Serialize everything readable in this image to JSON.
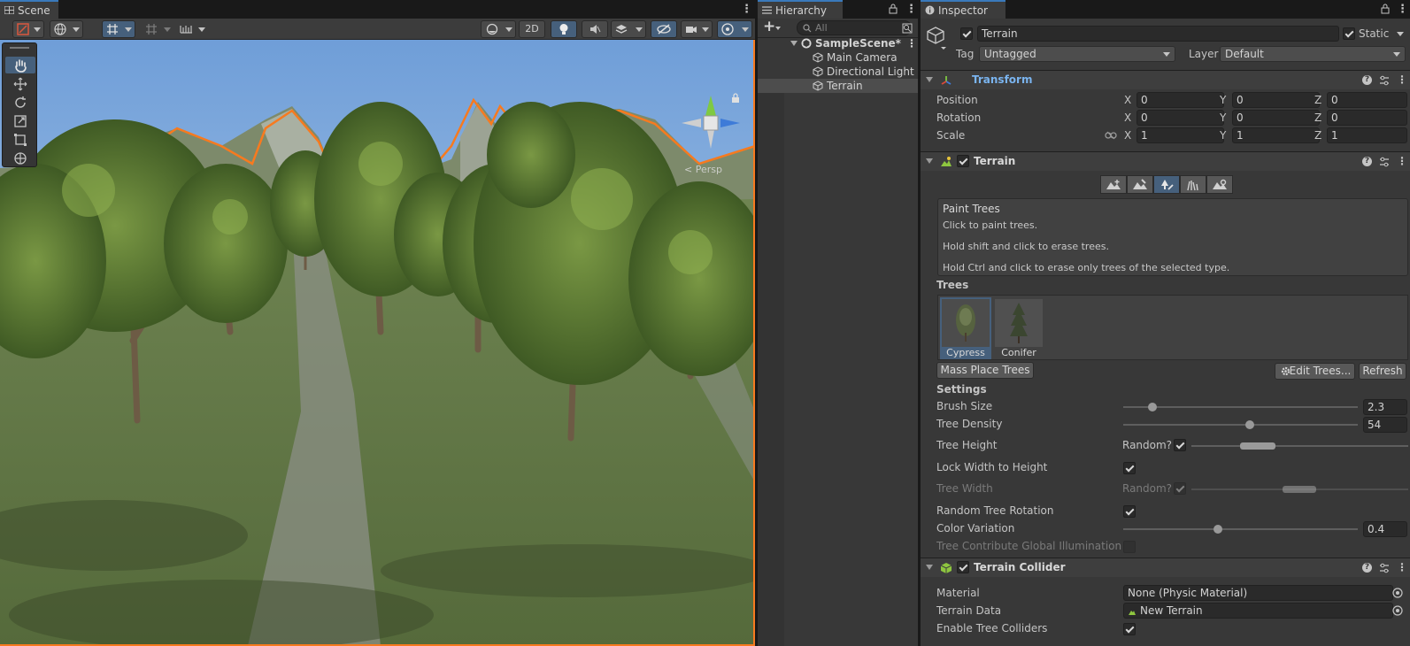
{
  "scene": {
    "tab": "Scene",
    "btn_2d": "2D",
    "persp_label": "< Persp"
  },
  "hierarchy": {
    "tab": "Hierarchy",
    "search_placeholder": "All",
    "scene_name": "SampleScene*",
    "items": [
      {
        "label": "Main Camera"
      },
      {
        "label": "Directional Light"
      },
      {
        "label": "Terrain"
      }
    ]
  },
  "inspector": {
    "tab": "Inspector",
    "object_name": "Terrain",
    "static_label": "Static",
    "tag_label": "Tag",
    "tag_value": "Untagged",
    "layer_label": "Layer",
    "layer_value": "Default",
    "transform": {
      "title": "Transform",
      "position_label": "Position",
      "rotation_label": "Rotation",
      "scale_label": "Scale",
      "axis_x": "X",
      "axis_y": "Y",
      "axis_z": "Z",
      "position": [
        "0",
        "0",
        "0"
      ],
      "rotation": [
        "0",
        "0",
        "0"
      ],
      "scale": [
        "1",
        "1",
        "1"
      ]
    },
    "terrain": {
      "title": "Terrain",
      "help_title": "Paint Trees",
      "help_lines": [
        "Click to paint trees.",
        "Hold shift and click to erase trees.",
        "Hold Ctrl and click to erase only trees of the selected type."
      ],
      "trees_label": "Trees",
      "trees": [
        {
          "name": "Cypress"
        },
        {
          "name": "Conifer"
        }
      ],
      "mass_place_btn": "Mass Place Trees",
      "edit_trees_btn": "Edit Trees...",
      "refresh_btn": "Refresh",
      "settings_label": "Settings",
      "brush_size_label": "Brush Size",
      "brush_size": "2.3",
      "brush_size_slider": 0.11,
      "tree_density_label": "Tree Density",
      "tree_density": "54",
      "tree_density_slider": 0.54,
      "tree_height_label": "Tree Height",
      "random_label": "Random?",
      "lock_width_label": "Lock Width to Height",
      "tree_width_label": "Tree Width",
      "random_rotation_label": "Random Tree Rotation",
      "color_variation_label": "Color Variation",
      "color_variation": "0.4",
      "color_variation_slider": 0.4,
      "contribute_gi_label": "Tree Contribute Global Illumination"
    },
    "collider": {
      "title": "Terrain Collider",
      "material_label": "Material",
      "material_value": "None (Physic Material)",
      "terrain_data_label": "Terrain Data",
      "terrain_data_value": "New Terrain",
      "enable_colliders_label": "Enable Tree Colliders"
    }
  },
  "colors": {
    "accent": "#3a79bb",
    "selected": "#46607c",
    "selection_outline": "#f77a1f",
    "panel": "#383838"
  }
}
